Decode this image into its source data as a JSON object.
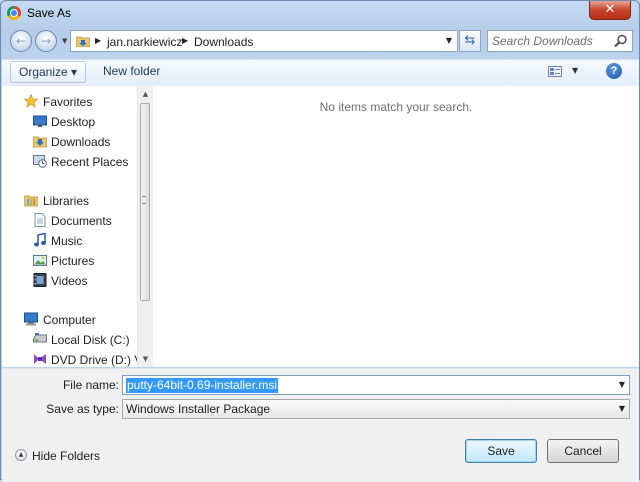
{
  "window": {
    "title": "Save As",
    "close_glyph": "✕"
  },
  "nav": {
    "back_glyph": "←",
    "forward_glyph": "→",
    "breadcrumb": [
      "jan.narkiewicz",
      "Downloads"
    ],
    "refresh_glyph": "⇆",
    "search_placeholder": "Search Downloads"
  },
  "toolbar": {
    "organize_label": "Organize ▾",
    "new_folder_label": "New folder",
    "help_glyph": "?"
  },
  "sidebar": {
    "favorites": {
      "label": "Favorites",
      "items": [
        {
          "label": "Desktop",
          "icon": "desktop-icon"
        },
        {
          "label": "Downloads",
          "icon": "downloads-icon"
        },
        {
          "label": "Recent Places",
          "icon": "recent-places-icon"
        }
      ]
    },
    "libraries": {
      "label": "Libraries",
      "items": [
        {
          "label": "Documents",
          "icon": "documents-icon"
        },
        {
          "label": "Music",
          "icon": "music-icon"
        },
        {
          "label": "Pictures",
          "icon": "pictures-icon"
        },
        {
          "label": "Videos",
          "icon": "videos-icon"
        }
      ]
    },
    "computer": {
      "label": "Computer",
      "items": [
        {
          "label": "Local Disk (C:)",
          "icon": "local-disk-icon"
        },
        {
          "label": "DVD Drive (D:) VS",
          "icon": "dvd-drive-icon"
        }
      ]
    }
  },
  "content": {
    "empty_message": "No items match your search."
  },
  "form": {
    "file_name_label": "File name:",
    "file_name_value": "putty-64bit-0.69-installer.msi",
    "save_type_label": "Save as type:",
    "save_type_value": "Windows Installer Package"
  },
  "footer": {
    "hide_folders_label": "Hide Folders",
    "save_label": "Save",
    "cancel_label": "Cancel"
  },
  "colors": {
    "selection": "#3399ff",
    "close_red": "#c7432a",
    "frame_blue": "#bcd3ee"
  }
}
